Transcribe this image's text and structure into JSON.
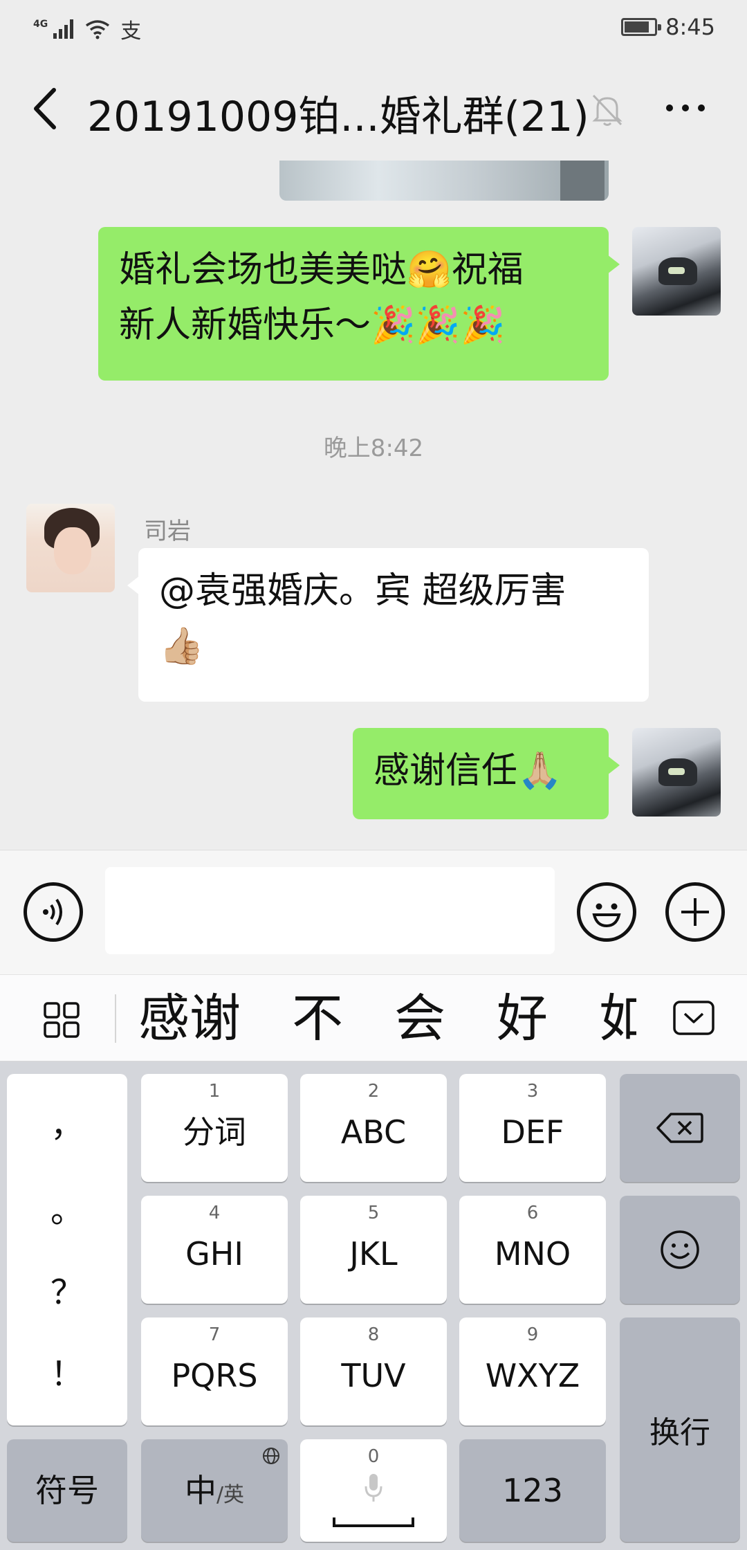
{
  "status_bar": {
    "network": "4G",
    "pay_glyph": "支",
    "battery_level": 0.75,
    "time": "8:45"
  },
  "header": {
    "title": "20191009铂...婚礼群(21)"
  },
  "chat": {
    "messages": [
      {
        "sender": "me",
        "text_before_emoji": "婚礼会场也美美哒",
        "emoji_1": "🤗",
        "text_after_emoji": "祝福",
        "line2": "新人新婚快乐～",
        "emoji_2": "🎉🎉🎉"
      },
      {
        "type": "timestamp",
        "text": "晚上8:42"
      },
      {
        "sender": "司岩",
        "text": "@袁强婚庆。宾  超级厉害",
        "emoji": "👍🏼"
      },
      {
        "sender": "me",
        "text": "感谢信任",
        "emoji": "🙏🏼"
      }
    ]
  },
  "input": {
    "value": ""
  },
  "candidates": [
    "感谢",
    "不",
    "会",
    "好",
    "如"
  ],
  "keyboard": {
    "punct": [
      "，",
      "。",
      "？",
      "！"
    ],
    "keys": [
      {
        "num": "1",
        "label": "分词"
      },
      {
        "num": "2",
        "label": "ABC"
      },
      {
        "num": "3",
        "label": "DEF"
      },
      {
        "num": "4",
        "label": "GHI"
      },
      {
        "num": "5",
        "label": "JKL"
      },
      {
        "num": "6",
        "label": "MNO"
      },
      {
        "num": "7",
        "label": "PQRS"
      },
      {
        "num": "8",
        "label": "TUV"
      },
      {
        "num": "9",
        "label": "WXYZ"
      }
    ],
    "symbol_label": "符号",
    "lang_label_main": "中",
    "lang_label_sub": "/英",
    "space_num": "0",
    "num_label": "123",
    "enter_label": "换行"
  }
}
